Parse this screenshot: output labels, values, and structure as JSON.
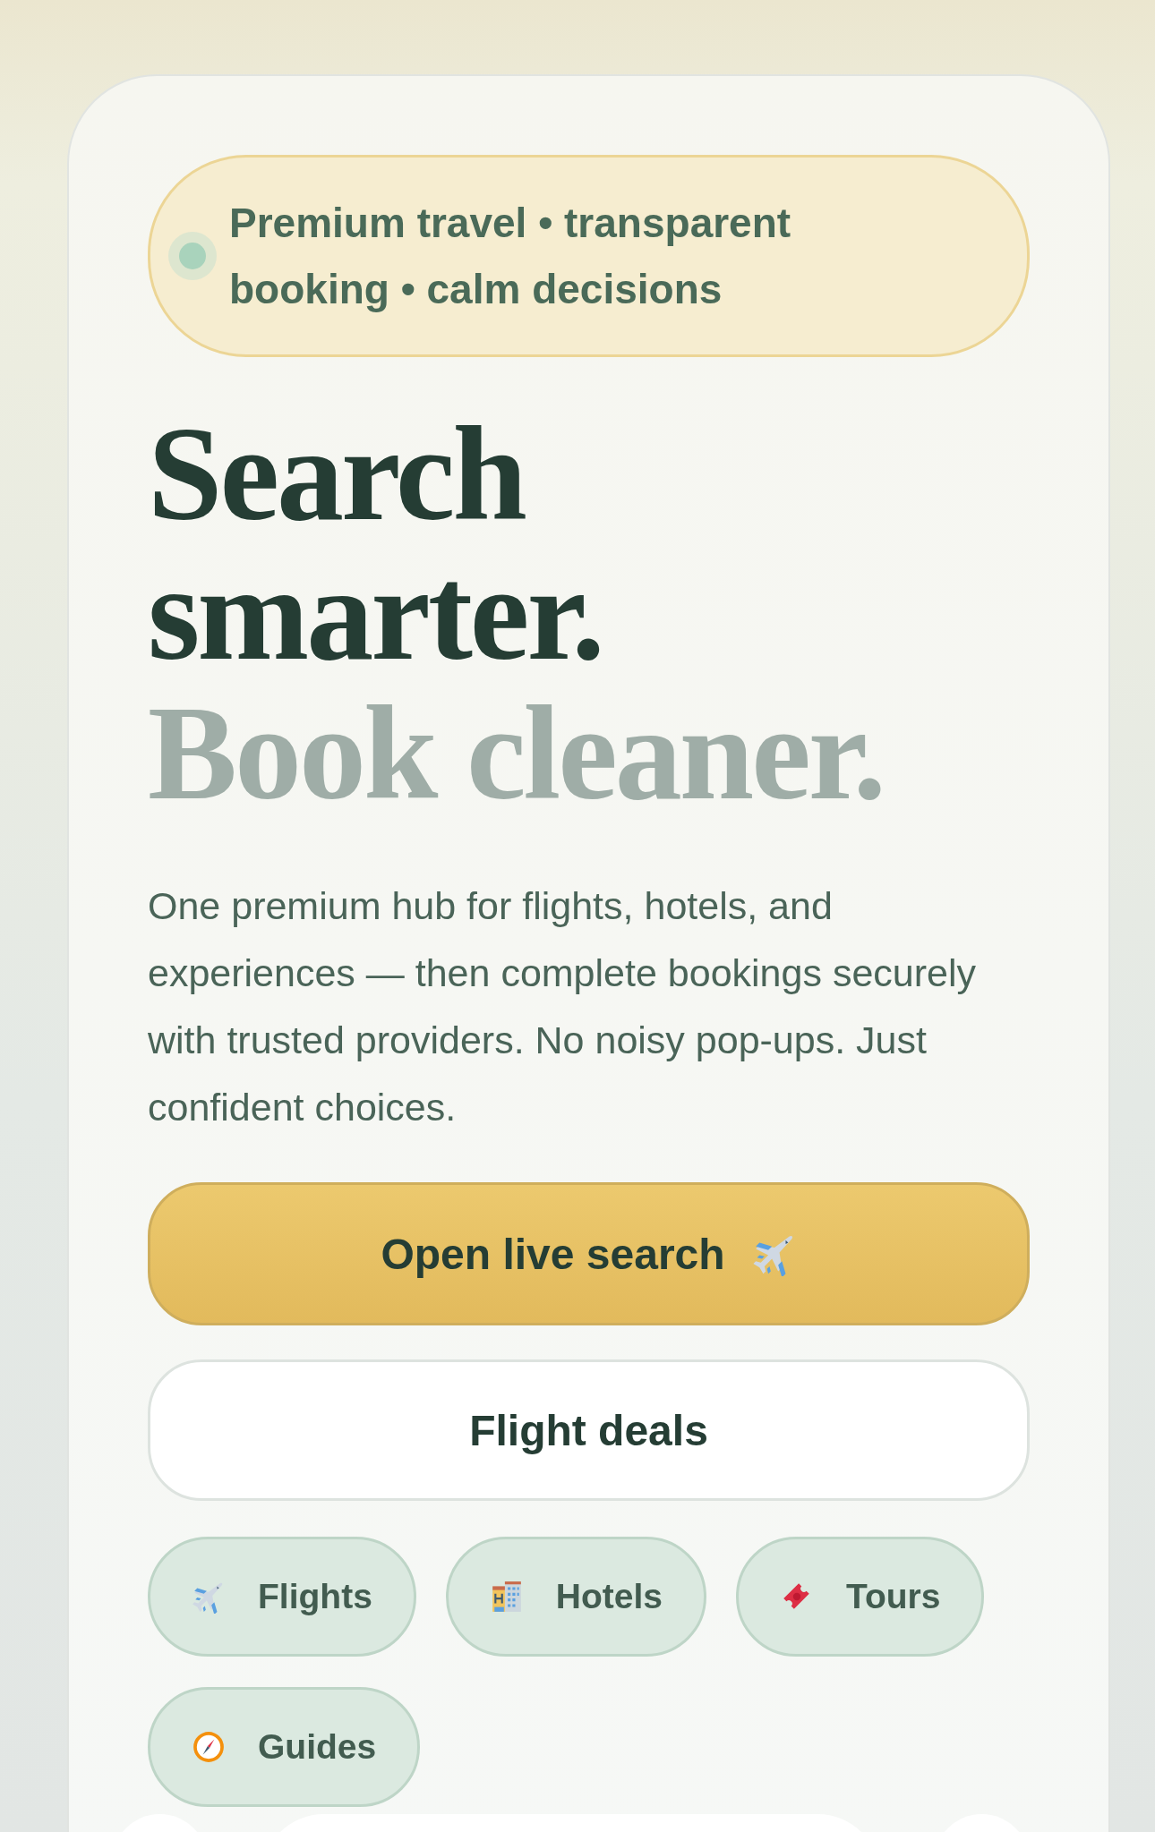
{
  "badge": {
    "text": "Premium travel • transparent booking • calm decisions",
    "color": "#a9d3bc"
  },
  "headline": [
    {
      "text": "Search smarter.",
      "kind": "primary"
    },
    {
      "text": "Book cleaner.",
      "kind": "muted"
    }
  ],
  "description": "One premium hub for flights, hotels, and experiences — then complete bookings securely with trusted providers. No noisy pop-ups. Just confident choices.",
  "primary_button": {
    "label": "Open live search"
  },
  "secondary_button": {
    "label": "Flight deals"
  },
  "categories": [
    {
      "label": "Flights",
      "kind": "flight"
    },
    {
      "label": "Hotels",
      "kind": "hotel"
    },
    {
      "label": "Tours",
      "kind": "tour"
    },
    {
      "label": "Guides",
      "kind": "guide"
    }
  ]
}
